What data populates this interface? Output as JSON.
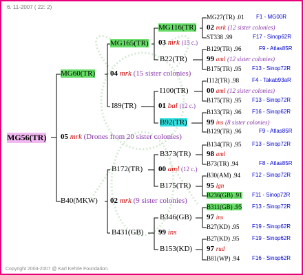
{
  "header": {
    "date": "6. 11-2007 ( 22: 2)"
  },
  "footer": {
    "copyright": "Copyright 2004-2007 @ Karl Kehrle Foundation."
  },
  "colors": {
    "border": "#e8007a",
    "highlight": "#66dd66",
    "highlight_cyan": "#33e0e0",
    "root": "#f2b8f2",
    "red": "#cc0000",
    "blue": "#0000cc",
    "purple": "#8833aa"
  },
  "gen1": {
    "root": "MG56(TR)",
    "year": "05",
    "race": "mrk",
    "note": "(Drones from 20 sister colonies)"
  },
  "gen2": {
    "upper": {
      "id": "MG60(TR)",
      "year": "04",
      "race": "mrk",
      "note": "(15 sister colonies)"
    },
    "lower": {
      "id": "B40(MKW)",
      "year": "02",
      "race": "mrk",
      "note": "(9 sister colonies)"
    }
  },
  "gen3": {
    "a": {
      "id": "MG165(TR)",
      "year": "03",
      "race": "mrk",
      "note": "(15 c.)"
    },
    "b": {
      "id": "I89(TR)",
      "year": "01",
      "race": "bal",
      "note": "(12 c.)"
    },
    "c": {
      "id": "B172(TR)",
      "year": "00",
      "race": "aml",
      "note": "(12 c.)"
    },
    "d": {
      "id": "B431(GB)",
      "year": "99",
      "race": "ins",
      "note": ""
    }
  },
  "gen4": [
    {
      "id": "MG116(TR)",
      "year": "02",
      "race": "mrk",
      "note": "(12 sister colonies)"
    },
    {
      "id": "B22(TR)",
      "year": "99",
      "race": "aml",
      "note": "(12 sister colonies)"
    },
    {
      "id": "I100(TR)",
      "year": "00",
      "race": "aml",
      "note": "(12 sister colonies)"
    },
    {
      "id": "B92(TR)",
      "year": "99",
      "race": "ins",
      "note": "(8 sister colonies)"
    },
    {
      "id": "B373(TR)",
      "year": "98",
      "race": "aml",
      "note": ""
    },
    {
      "id": "B175(TR)",
      "year": "95",
      "race": "lgn",
      "note": ""
    },
    {
      "id": "B346(GB)",
      "year": "97",
      "race": "ins",
      "note": ""
    },
    {
      "id": "B153(KD)",
      "year": "97",
      "race": "rud",
      "note": ""
    }
  ],
  "gen5": [
    {
      "id": "MG27(TR)",
      "val": ".01",
      "src": "F1 - MG00R"
    },
    {
      "id": "ST338",
      "val": ".99",
      "src": "F17 - Sinop62R"
    },
    {
      "id": "B129(TR)",
      "val": ".96",
      "src": "F9 - Atlas85R"
    },
    {
      "id": "B175(TR)",
      "val": ".95",
      "src": "F13 - Sinop72R"
    },
    {
      "id": "I112(TR)",
      "val": ".98",
      "src": "F4 - Takab93aR"
    },
    {
      "id": "B175(TR)",
      "val": ".95",
      "src": "F13 - Sinop72R"
    },
    {
      "id": "B133(TR)",
      "val": ".96",
      "src": "F16 - Sinop62R"
    },
    {
      "id": "B129(TR)",
      "val": ".96",
      "src": "F9 - Atlas85R"
    },
    {
      "id": "B134(TR)",
      "val": ".95",
      "src": "F13 - Sinop72R"
    },
    {
      "id": "B73(TR)",
      "val": ".94",
      "src": "F8 - Atlas85R"
    },
    {
      "id": "B30(AM)",
      "val": ".94",
      "src": "F12 - Sinop72R"
    },
    {
      "id": "B236(GB)",
      "val": ".91",
      "src": "F11 - Sinop72R"
    },
    {
      "id": "B311(GB)",
      "val": ".95",
      "src": "F13 - Sinop72R"
    },
    {
      "id": "B27(KD)",
      "val": ".95",
      "src": "F19 - Sinop62R"
    },
    {
      "id": "B27(KD)",
      "val": ".95",
      "src": "F19 - Sinop62R"
    },
    {
      "id": "B81(WP)",
      "val": ".94",
      "src": "F16 - Sinop62R"
    }
  ]
}
